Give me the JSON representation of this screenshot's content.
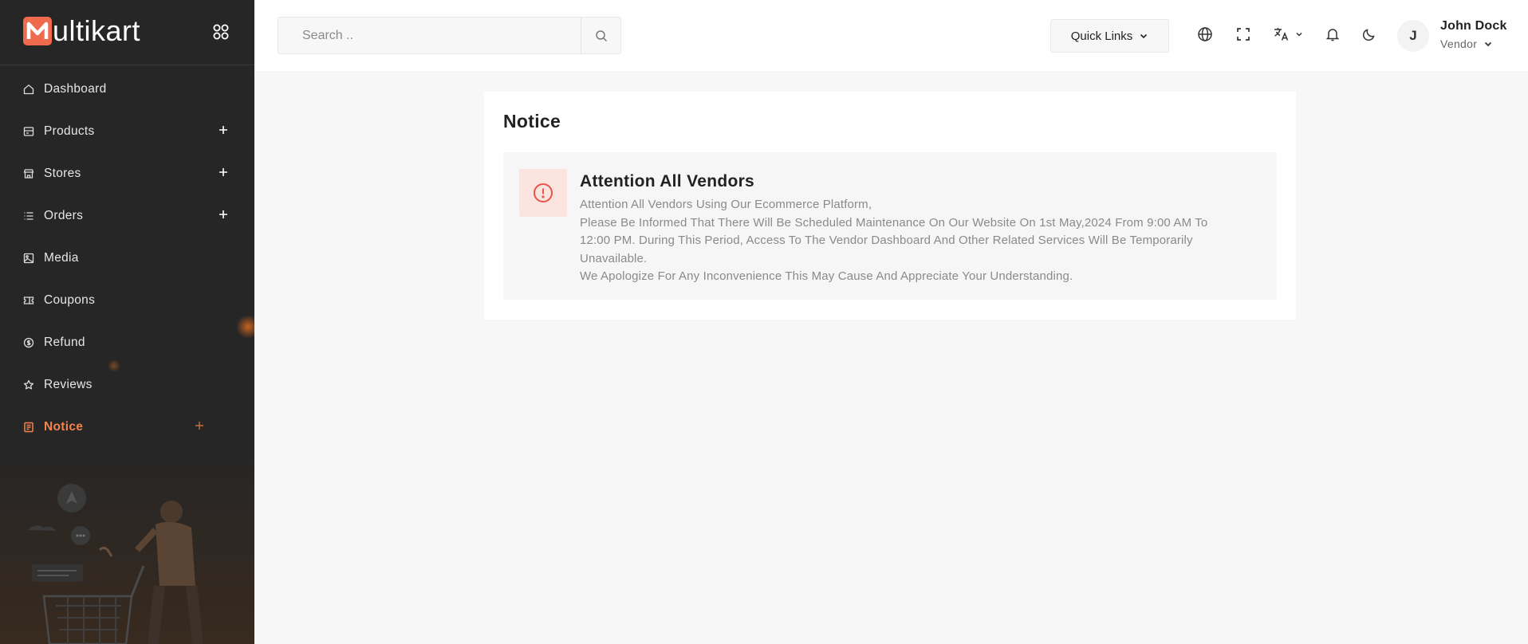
{
  "brand": {
    "logo_initial": "M",
    "logo_rest": "ultikart"
  },
  "sidebar": {
    "items": [
      {
        "label": "Dashboard",
        "icon": "home-icon",
        "expandable": false,
        "active": false
      },
      {
        "label": "Products",
        "icon": "products-icon",
        "expandable": true,
        "active": false
      },
      {
        "label": "Stores",
        "icon": "store-icon",
        "expandable": true,
        "active": false
      },
      {
        "label": "Orders",
        "icon": "list-icon",
        "expandable": true,
        "active": false
      },
      {
        "label": "Media",
        "icon": "image-icon",
        "expandable": false,
        "active": false
      },
      {
        "label": "Coupons",
        "icon": "coupon-icon",
        "expandable": false,
        "active": false
      },
      {
        "label": "Refund",
        "icon": "refund-icon",
        "expandable": false,
        "active": false
      },
      {
        "label": "Reviews",
        "icon": "star-icon",
        "expandable": false,
        "active": false
      },
      {
        "label": "Notice",
        "icon": "notice-icon",
        "expandable": false,
        "active": true
      }
    ]
  },
  "header": {
    "search_placeholder": "Search ..",
    "quick_links_label": "Quick Links",
    "user": {
      "initial": "J",
      "name": "John Dock",
      "role": "Vendor"
    }
  },
  "main": {
    "page_title": "Notice",
    "notice": {
      "title": "Attention All Vendors",
      "lines": [
        "Attention All Vendors Using Our Ecommerce Platform,",
        "Please Be Informed That There Will Be Scheduled Maintenance On Our Website On 1st May,2024 From 9:00 AM To 12:00 PM. During This Period, Access To The Vendor Dashboard And Other Related Services Will Be Temporarily Unavailable.",
        "We Apologize For Any Inconvenience This May Cause And Appreciate Your Understanding."
      ]
    }
  },
  "colors": {
    "accent": "#f3834d",
    "sidebar_bg": "#262626",
    "alert": "#e8534a"
  }
}
